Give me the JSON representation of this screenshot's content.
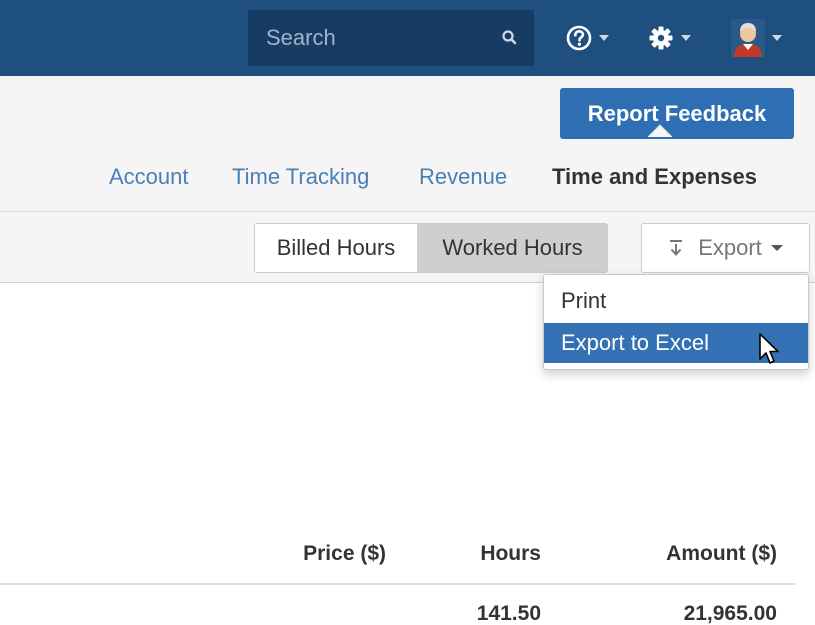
{
  "navbar": {
    "search": {
      "placeholder": "Search"
    },
    "icons": [
      "search-icon",
      "help-icon",
      "gear-icon",
      "user-avatar"
    ],
    "colors": {
      "bar": "#1f4f7e",
      "search_bg": "#163c63"
    }
  },
  "subheader": {
    "feedback_label": "Report Feedback",
    "tabs": [
      {
        "label": "Account",
        "active": false
      },
      {
        "label": "Time Tracking",
        "active": false
      },
      {
        "label": "Revenue",
        "active": false
      },
      {
        "label": "Time and Expenses",
        "active": true
      }
    ]
  },
  "toolbar": {
    "toggle": [
      {
        "label": "Billed Hours",
        "active": false
      },
      {
        "label": "Worked Hours",
        "active": true
      }
    ],
    "export_label": "Export",
    "export_menu": [
      {
        "label": "Print",
        "highlighted": false
      },
      {
        "label": "Export to Excel",
        "highlighted": true
      }
    ]
  },
  "table": {
    "columns": [
      "Price ($)",
      "Hours",
      "Amount ($)"
    ],
    "rows": [
      {
        "price": "",
        "hours": "141.50",
        "amount": "21,965.00"
      }
    ]
  },
  "colors": {
    "accent": "#2e6fb4",
    "link": "#4a7fb5",
    "menu_highlight": "#3370b4"
  }
}
